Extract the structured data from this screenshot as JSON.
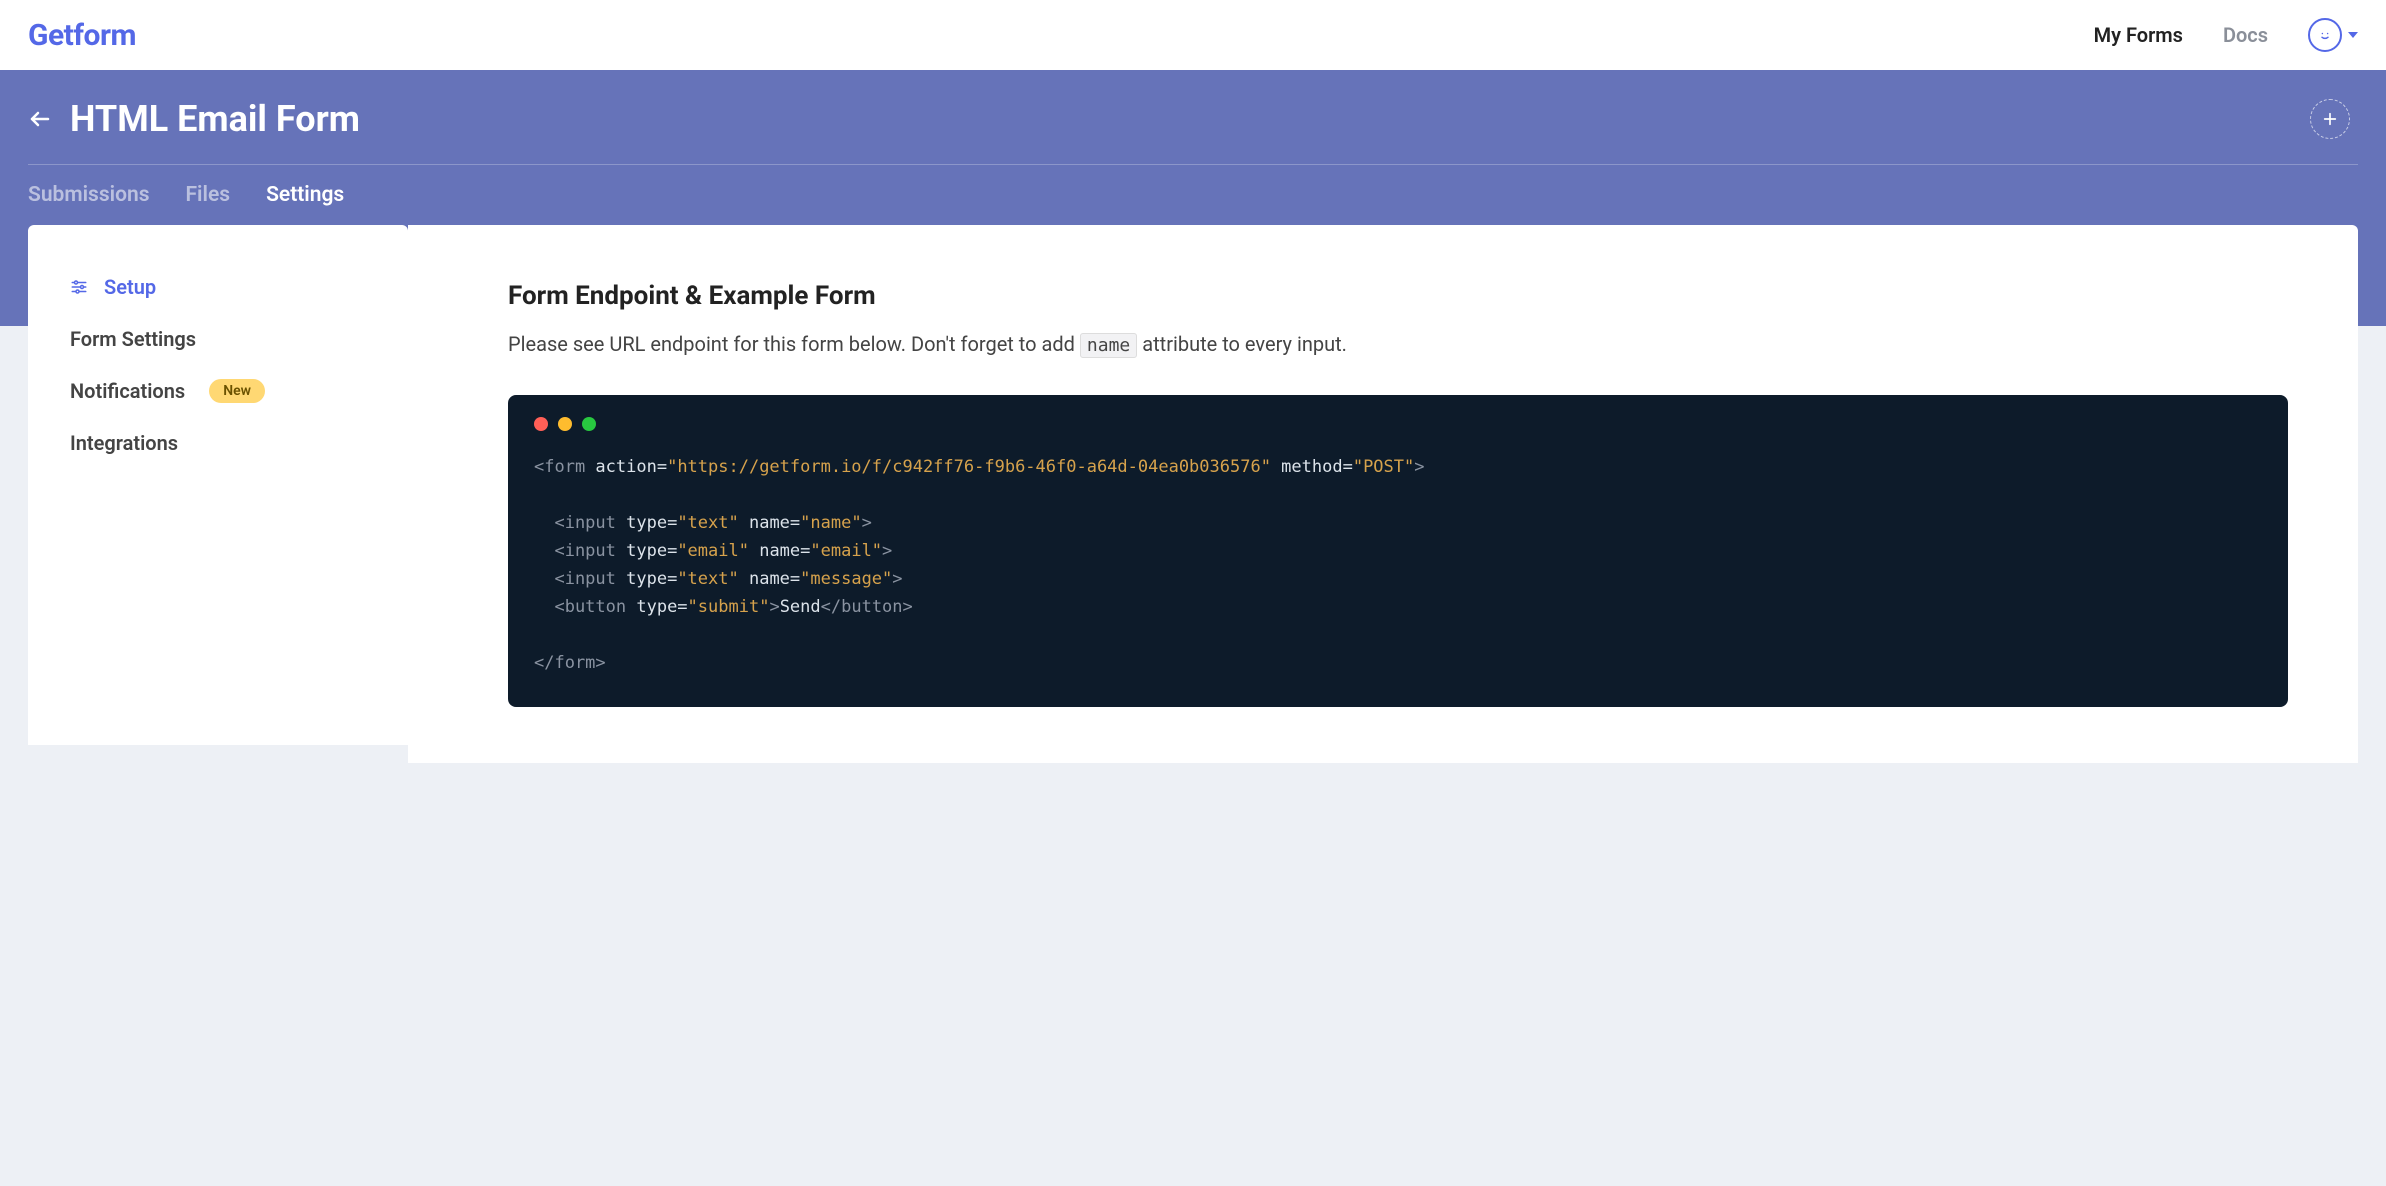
{
  "brand": "Getform",
  "topnav": {
    "my_forms": "My Forms",
    "docs": "Docs"
  },
  "hero": {
    "title": "HTML Email Form",
    "tabs": {
      "submissions": "Submissions",
      "files": "Files",
      "settings": "Settings"
    }
  },
  "sidebar": {
    "setup": "Setup",
    "form_settings": "Form Settings",
    "notifications": "Notifications",
    "notifications_badge": "New",
    "integrations": "Integrations"
  },
  "main": {
    "heading": "Form Endpoint & Example Form",
    "desc_prefix": "Please see URL endpoint for this form below. Don't forget to add ",
    "desc_code": "name",
    "desc_suffix": " attribute to every input."
  },
  "code": {
    "form_open_1": "<form",
    "action_attr": " action=",
    "action_val": "\"https://getform.io/f/c942ff76-f9b6-46f0-a64d-04ea0b036576\"",
    "method_attr": " method=",
    "method_val": "\"POST\"",
    "tag_close": ">",
    "input1_a": "<input",
    "type_attr": " type=",
    "name_attr": " name=",
    "text_val": "\"text\"",
    "email_val": "\"email\"",
    "name_name_val": "\"name\"",
    "name_email_val": "\"email\"",
    "name_message_val": "\"message\"",
    "button_open": "<button",
    "submit_val": "\"submit\"",
    "button_text": "Send",
    "button_close": "</button>",
    "form_close": "</form>"
  }
}
